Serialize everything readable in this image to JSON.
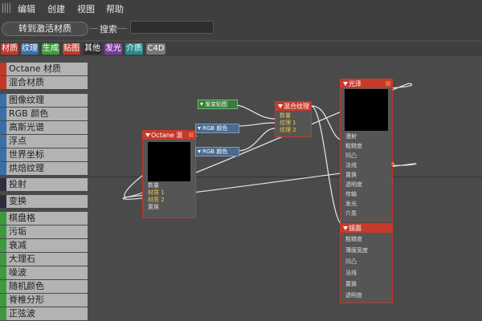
{
  "menu": {
    "edit": "编辑",
    "create": "创建",
    "view": "视图",
    "help": "帮助"
  },
  "toolbar": {
    "activate_material": "转到激活材质",
    "search_label": "搜索",
    "search_placeholder": ""
  },
  "tabs": [
    {
      "label": "材质",
      "color": "#c4382c"
    },
    {
      "label": "纹理",
      "color": "#3b6fa8"
    },
    {
      "label": "生成",
      "color": "#3f9a3f"
    },
    {
      "label": "贴图",
      "color": "#c4382c"
    },
    {
      "label": "其他",
      "color": "#2d2d2d"
    },
    {
      "label": "发光",
      "color": "#7a3aa0"
    },
    {
      "label": "介质",
      "color": "#2a8a8a"
    },
    {
      "label": "C4D",
      "color": "#777777"
    }
  ],
  "sidebar": {
    "items": [
      {
        "label": "Octane 材质",
        "color": "#c4382c"
      },
      {
        "label": "混合材质",
        "color": "#c4382c"
      },
      {
        "label": "图像纹理",
        "color": "#3b6fa8"
      },
      {
        "label": "RGB 颜色",
        "color": "#3b6fa8"
      },
      {
        "label": "高斯光谱",
        "color": "#3b6fa8"
      },
      {
        "label": "浮点",
        "color": "#3b6fa8"
      },
      {
        "label": "世界坐标",
        "color": "#3b6fa8"
      },
      {
        "label": "烘焙纹理",
        "color": "#3b6fa8"
      },
      {
        "label": "投射",
        "color": "#2d2d40"
      },
      {
        "label": "变换",
        "color": "#2d2d40"
      },
      {
        "label": "棋盘格",
        "color": "#3f9a3f"
      },
      {
        "label": "污垢",
        "color": "#3f9a3f"
      },
      {
        "label": "衰减",
        "color": "#3f9a3f"
      },
      {
        "label": "大理石",
        "color": "#3f9a3f"
      },
      {
        "label": "噪波",
        "color": "#3f9a3f"
      },
      {
        "label": "随机颜色",
        "color": "#3f9a3f"
      },
      {
        "label": "脊椎分形",
        "color": "#3f9a3f"
      },
      {
        "label": "正弦波",
        "color": "#3f9a3f"
      }
    ]
  },
  "nodes": {
    "octane": {
      "title": "Octane 混",
      "ports": [
        "数量",
        "材质 1",
        "材质 2",
        "置换"
      ]
    },
    "mix_texture": {
      "title": "混合纹理",
      "ports": [
        "数量",
        "纹理 1",
        "纹理 2"
      ]
    },
    "gradient": {
      "title": "渐变贴图"
    },
    "rgb1": {
      "title": "RGB 颜色"
    },
    "rgb2": {
      "title": "RGB 颜色"
    },
    "glossy": {
      "title": "光泽",
      "ports": [
        "漫射",
        "粗糙度",
        "凹凸",
        "法线",
        "置换",
        "透明度",
        "传输",
        "发光",
        "介质"
      ]
    },
    "specular": {
      "title": "镜面",
      "ports": [
        "粗糙度",
        "薄膜宽度",
        "凹凸",
        "法线",
        "置换",
        "透明度"
      ]
    }
  }
}
